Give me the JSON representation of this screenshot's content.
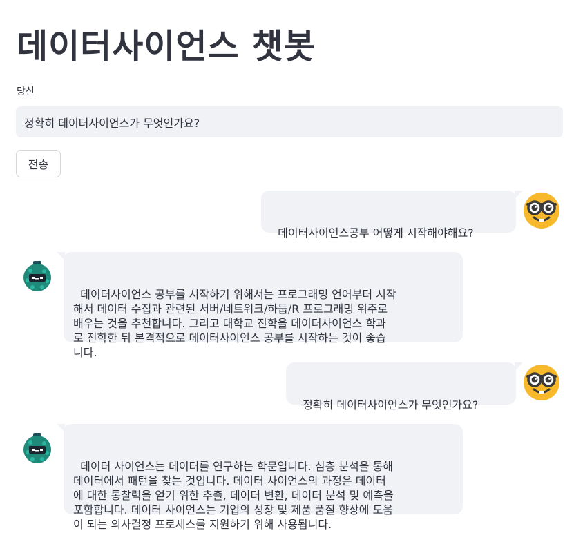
{
  "page": {
    "title": "데이터사이언스 챗봇"
  },
  "input": {
    "label": "당신",
    "value": "정확히 데이터사이언스가 무엇인가요?"
  },
  "send_button": {
    "label": "전송"
  },
  "messages": [
    {
      "role": "user",
      "text": "데이터사이언스공부 어떻게 시작해야해요?",
      "avatar_icon": "nerd-face-emoji"
    },
    {
      "role": "bot",
      "text": "데이터사이언스 공부를 시작하기 위해서는 프로그래밍 언어부터 시작\n해서 데이터 수집과 관련된 서버/네트워크/하둡/R 프로그래밍 위주로\n배우는 것을 추천합니다. 그리고 대학교 진학을 데이터사이언스 학과\n로 진학한 뒤 본격적으로 데이터사이언스 공부를 시작하는 것이 좋습\n니다.",
      "avatar_icon": "robot-avatar"
    },
    {
      "role": "user",
      "text": "정확히 데이터사이언스가 무엇인가요?",
      "avatar_icon": "nerd-face-emoji"
    },
    {
      "role": "bot",
      "text": "데이터 사이언스는 데이터를 연구하는 학문입니다. 심층 분석을 통해\n데이터에서 패턴을 찾는 것입니다. 데이터 사이언스의 과정은 데이터\n에 대한 통찰력을 얻기 위한 추출, 데이터 변환, 데이터 분석 및 예측을\n포함합니다. 데이터 사이언스는 기업의 성장 및 제품 품질 향상에 도움\n이 되는 의사결정 프로세스를 지원하기 위해 사용됩니다.",
      "avatar_icon": "robot-avatar"
    }
  ],
  "colors": {
    "bubble_bg": "#f0f2f6",
    "text": "#31333f",
    "emoji_yellow": "#f7b92b",
    "robot_teal": "#1f8a7a"
  }
}
